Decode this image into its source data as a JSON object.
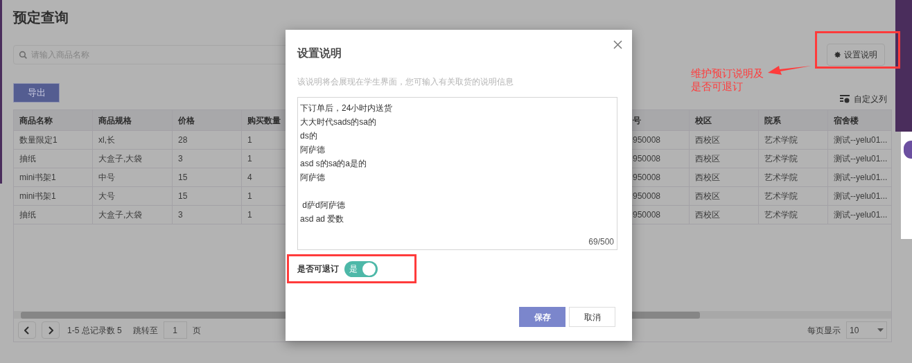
{
  "page": {
    "title": "预定查询",
    "search": {
      "placeholder": "请输入商品名称"
    },
    "settings_button": "设置说明",
    "export_button": "导出",
    "custom_columns": "自定义列"
  },
  "table": {
    "columns": [
      "商品名称",
      "商品规格",
      "价格",
      "购买数量",
      "号",
      "校区",
      "院系",
      "宿舍楼"
    ],
    "rows": [
      [
        "数量限定1",
        "xl,长",
        "28",
        "1",
        "950008",
        "西校区",
        "艺术学院",
        "测试--yelu01..."
      ],
      [
        "抽纸",
        "大盒子,大袋",
        "3",
        "1",
        "950008",
        "西校区",
        "艺术学院",
        "测试--yelu01..."
      ],
      [
        "mini书架1",
        "中号",
        "15",
        "4",
        "950008",
        "西校区",
        "艺术学院",
        "测试--yelu01..."
      ],
      [
        "mini书架1",
        "大号",
        "15",
        "1",
        "950008",
        "西校区",
        "艺术学院",
        "测试--yelu01..."
      ],
      [
        "抽纸",
        "大盒子,大袋",
        "3",
        "1",
        "950008",
        "西校区",
        "艺术学院",
        "测试--yelu01..."
      ]
    ]
  },
  "pagination": {
    "summary": "1-5 总记录数 5",
    "jump_label": "跳转至",
    "page_value": "1",
    "page_suffix": "页",
    "page_size_label": "每页显示",
    "page_size": "10"
  },
  "dialog": {
    "title": "设置说明",
    "hint": "该说明将会展现在学生界面，您可输入有关取货的说明信息",
    "description": [
      [
        "下订单后，24小时内送货",
        "大大时代sads的sa的",
        "ds的",
        "阿萨德",
        "asd s的sa的a是的",
        "阿萨德"
      ],
      [
        " d萨d阿萨德",
        "asd ad 爱数"
      ]
    ],
    "counter": "69/500",
    "refund_label": "是否可退订",
    "refund": {
      "on": true,
      "label": "是"
    },
    "buttons": [
      "保存",
      "取消"
    ]
  },
  "annotation": {
    "lines": [
      "维护预订说明及",
      "是否可退订"
    ]
  }
}
